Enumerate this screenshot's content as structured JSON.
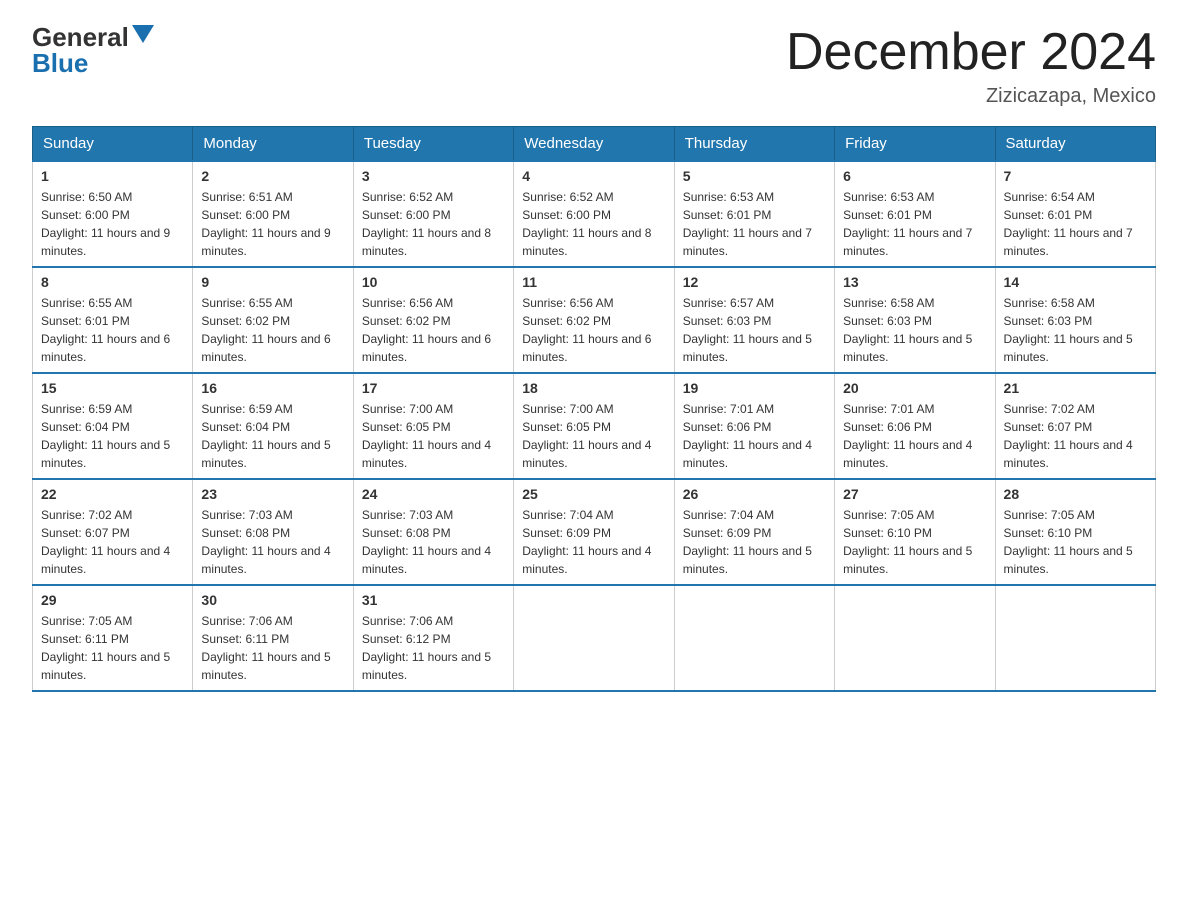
{
  "header": {
    "logo_general": "General",
    "logo_blue": "Blue",
    "title": "December 2024",
    "location": "Zizicazapa, Mexico"
  },
  "days_of_week": [
    "Sunday",
    "Monday",
    "Tuesday",
    "Wednesday",
    "Thursday",
    "Friday",
    "Saturday"
  ],
  "weeks": [
    [
      {
        "num": "1",
        "sunrise": "6:50 AM",
        "sunset": "6:00 PM",
        "daylight": "11 hours and 9 minutes."
      },
      {
        "num": "2",
        "sunrise": "6:51 AM",
        "sunset": "6:00 PM",
        "daylight": "11 hours and 9 minutes."
      },
      {
        "num": "3",
        "sunrise": "6:52 AM",
        "sunset": "6:00 PM",
        "daylight": "11 hours and 8 minutes."
      },
      {
        "num": "4",
        "sunrise": "6:52 AM",
        "sunset": "6:00 PM",
        "daylight": "11 hours and 8 minutes."
      },
      {
        "num": "5",
        "sunrise": "6:53 AM",
        "sunset": "6:01 PM",
        "daylight": "11 hours and 7 minutes."
      },
      {
        "num": "6",
        "sunrise": "6:53 AM",
        "sunset": "6:01 PM",
        "daylight": "11 hours and 7 minutes."
      },
      {
        "num": "7",
        "sunrise": "6:54 AM",
        "sunset": "6:01 PM",
        "daylight": "11 hours and 7 minutes."
      }
    ],
    [
      {
        "num": "8",
        "sunrise": "6:55 AM",
        "sunset": "6:01 PM",
        "daylight": "11 hours and 6 minutes."
      },
      {
        "num": "9",
        "sunrise": "6:55 AM",
        "sunset": "6:02 PM",
        "daylight": "11 hours and 6 minutes."
      },
      {
        "num": "10",
        "sunrise": "6:56 AM",
        "sunset": "6:02 PM",
        "daylight": "11 hours and 6 minutes."
      },
      {
        "num": "11",
        "sunrise": "6:56 AM",
        "sunset": "6:02 PM",
        "daylight": "11 hours and 6 minutes."
      },
      {
        "num": "12",
        "sunrise": "6:57 AM",
        "sunset": "6:03 PM",
        "daylight": "11 hours and 5 minutes."
      },
      {
        "num": "13",
        "sunrise": "6:58 AM",
        "sunset": "6:03 PM",
        "daylight": "11 hours and 5 minutes."
      },
      {
        "num": "14",
        "sunrise": "6:58 AM",
        "sunset": "6:03 PM",
        "daylight": "11 hours and 5 minutes."
      }
    ],
    [
      {
        "num": "15",
        "sunrise": "6:59 AM",
        "sunset": "6:04 PM",
        "daylight": "11 hours and 5 minutes."
      },
      {
        "num": "16",
        "sunrise": "6:59 AM",
        "sunset": "6:04 PM",
        "daylight": "11 hours and 5 minutes."
      },
      {
        "num": "17",
        "sunrise": "7:00 AM",
        "sunset": "6:05 PM",
        "daylight": "11 hours and 4 minutes."
      },
      {
        "num": "18",
        "sunrise": "7:00 AM",
        "sunset": "6:05 PM",
        "daylight": "11 hours and 4 minutes."
      },
      {
        "num": "19",
        "sunrise": "7:01 AM",
        "sunset": "6:06 PM",
        "daylight": "11 hours and 4 minutes."
      },
      {
        "num": "20",
        "sunrise": "7:01 AM",
        "sunset": "6:06 PM",
        "daylight": "11 hours and 4 minutes."
      },
      {
        "num": "21",
        "sunrise": "7:02 AM",
        "sunset": "6:07 PM",
        "daylight": "11 hours and 4 minutes."
      }
    ],
    [
      {
        "num": "22",
        "sunrise": "7:02 AM",
        "sunset": "6:07 PM",
        "daylight": "11 hours and 4 minutes."
      },
      {
        "num": "23",
        "sunrise": "7:03 AM",
        "sunset": "6:08 PM",
        "daylight": "11 hours and 4 minutes."
      },
      {
        "num": "24",
        "sunrise": "7:03 AM",
        "sunset": "6:08 PM",
        "daylight": "11 hours and 4 minutes."
      },
      {
        "num": "25",
        "sunrise": "7:04 AM",
        "sunset": "6:09 PM",
        "daylight": "11 hours and 4 minutes."
      },
      {
        "num": "26",
        "sunrise": "7:04 AM",
        "sunset": "6:09 PM",
        "daylight": "11 hours and 5 minutes."
      },
      {
        "num": "27",
        "sunrise": "7:05 AM",
        "sunset": "6:10 PM",
        "daylight": "11 hours and 5 minutes."
      },
      {
        "num": "28",
        "sunrise": "7:05 AM",
        "sunset": "6:10 PM",
        "daylight": "11 hours and 5 minutes."
      }
    ],
    [
      {
        "num": "29",
        "sunrise": "7:05 AM",
        "sunset": "6:11 PM",
        "daylight": "11 hours and 5 minutes."
      },
      {
        "num": "30",
        "sunrise": "7:06 AM",
        "sunset": "6:11 PM",
        "daylight": "11 hours and 5 minutes."
      },
      {
        "num": "31",
        "sunrise": "7:06 AM",
        "sunset": "6:12 PM",
        "daylight": "11 hours and 5 minutes."
      },
      null,
      null,
      null,
      null
    ]
  ]
}
